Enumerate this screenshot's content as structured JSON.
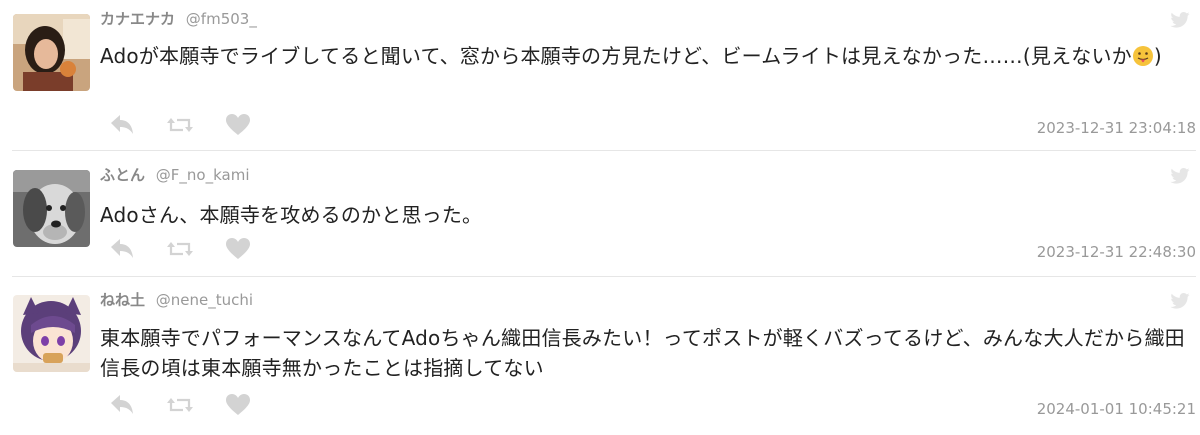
{
  "tweets": [
    {
      "name": "カナエナカ",
      "handle": "@fm503_",
      "text_main": "Adoが本願寺でライブしてると聞いて、窓から本願寺の方見たけど、ビームライトは見えなかった……(見えないか",
      "text_end": ")",
      "emoji": "face-with-tongue",
      "timestamp": "2023-12-31 23:04:18"
    },
    {
      "name": "ふとん",
      "handle": "@F_no_kami",
      "text": "Adoさん、本願寺を攻めるのかと思った。",
      "timestamp": "2023-12-31 22:48:30"
    },
    {
      "name": "ねね土",
      "handle": "@nene_tuchi",
      "text": "東本願寺でパフォーマンスなんてAdoちゃん織田信長みたい！ってポストが軽くバズってるけど、みんな大人だから織田信長の頃は東本願寺無かったことは指摘してない",
      "timestamp": "2024-01-01 10:45:21"
    }
  ],
  "colors": {
    "icon_gray": "#d3d3d3",
    "meta_gray": "#999999",
    "text": "#222222",
    "divider": "#e6e6e6"
  },
  "icons": [
    "reply-icon",
    "retweet-icon",
    "like-icon",
    "twitter-bird-icon"
  ]
}
